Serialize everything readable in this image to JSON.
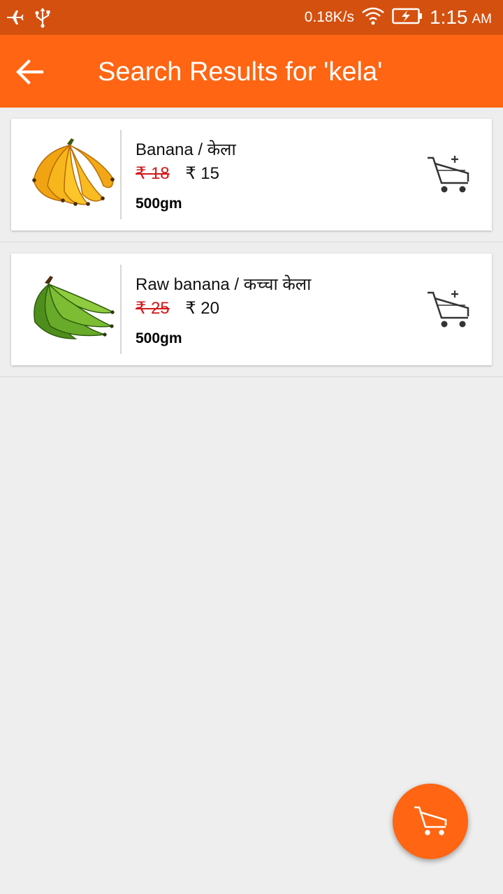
{
  "status_bar": {
    "net_speed": "0.18K/s",
    "time": "1:15",
    "ampm": "AM",
    "icons": [
      "airplane-icon",
      "usb-icon",
      "wifi-icon",
      "battery-charging-icon"
    ]
  },
  "app_bar": {
    "title": "Search Results for 'kela'",
    "back_icon": "arrow-left-icon"
  },
  "products": [
    {
      "name": "Banana / केला",
      "old_price": "₹ 18",
      "price": "₹ 15",
      "quantity": "500gm",
      "image": "ripe-banana-bunch",
      "action_icon": "add-to-cart-icon"
    },
    {
      "name": "Raw banana / कच्चा केला",
      "old_price": "₹ 25",
      "price": "₹ 20",
      "quantity": "500gm",
      "image": "raw-green-banana-bunch",
      "action_icon": "add-to-cart-icon"
    }
  ],
  "fab": {
    "icon": "cart-icon"
  },
  "colors": {
    "primary": "#ff6512",
    "status_bar": "#d4500f",
    "old_price": "#d21818",
    "background": "#eeeeee"
  }
}
